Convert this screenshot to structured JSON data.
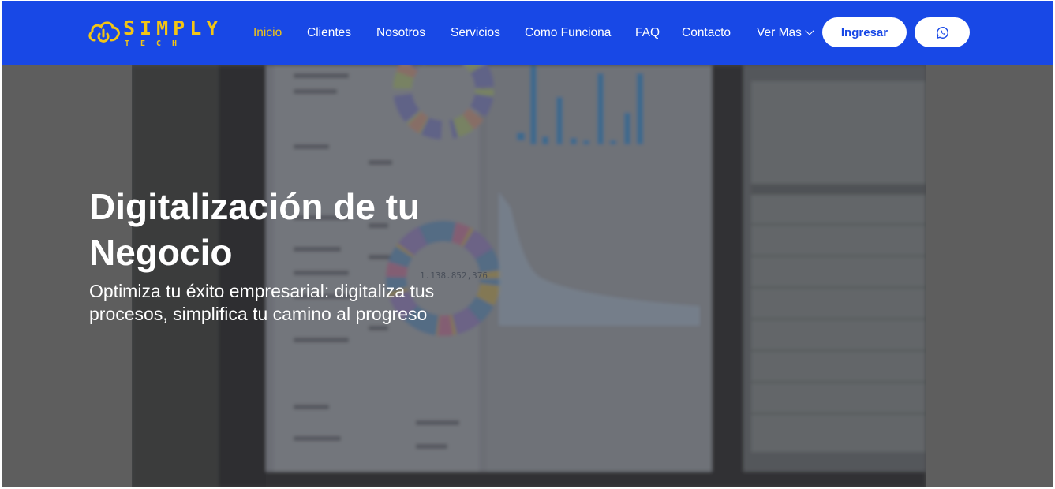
{
  "brand": {
    "name": "SIMPLY",
    "tagline": "TECH",
    "accent_color": "#f2c515",
    "nav_color": "#1848e6"
  },
  "nav": {
    "items": [
      {
        "label": "Inicio",
        "active": true
      },
      {
        "label": "Clientes",
        "active": false
      },
      {
        "label": "Nosotros",
        "active": false
      },
      {
        "label": "Servicios",
        "active": false
      },
      {
        "label": "Como Funciona",
        "active": false
      },
      {
        "label": "FAQ",
        "active": false
      },
      {
        "label": "Contacto",
        "active": false
      },
      {
        "label": "Ver Mas",
        "active": false,
        "dropdown": true
      }
    ],
    "login_label": "Ingresar",
    "whatsapp_icon": "whatsapp-icon"
  },
  "hero": {
    "title": "Digitalización de tu Negocio",
    "subtitle": "Optimiza tu éxito empresarial: digitaliza tus procesos, simplifica tu camino al progreso",
    "background": "blurred dashboard monitors",
    "chart_figure": "1.138.852,376"
  }
}
